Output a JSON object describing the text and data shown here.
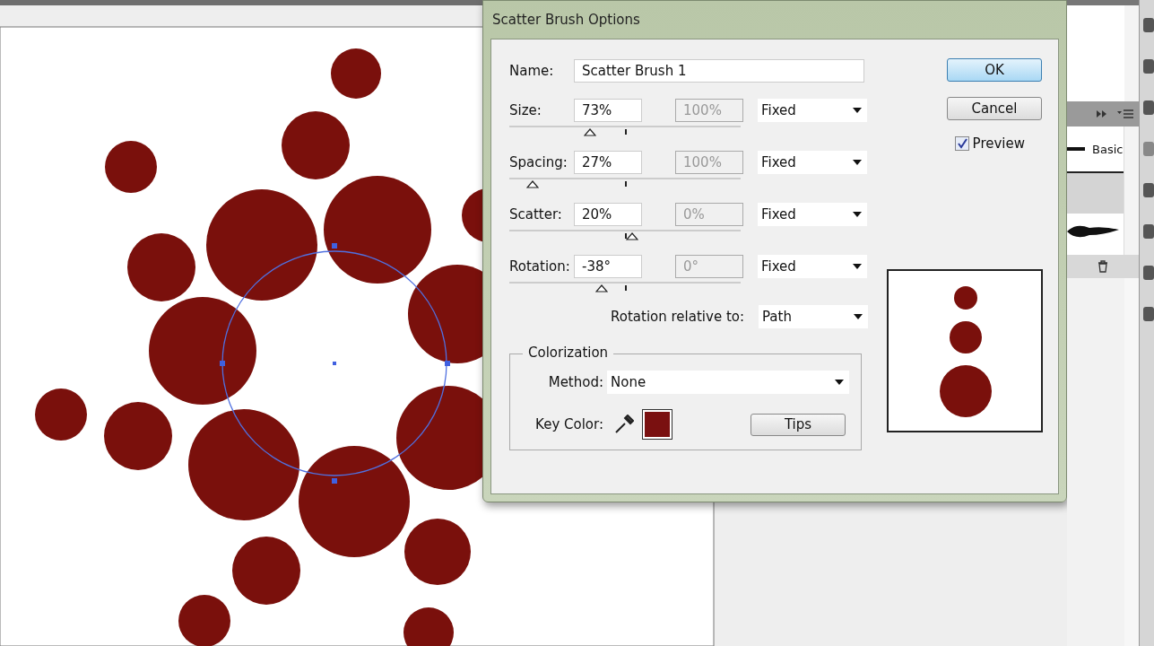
{
  "dialog": {
    "title": "Scatter Brush Options",
    "name": {
      "label": "Name:",
      "value": "Scatter Brush 1"
    },
    "parameters": [
      {
        "label": "Size:",
        "value": "73%",
        "other_value": "100%",
        "mode": "Fixed",
        "level": 0.35
      },
      {
        "label": "Spacing:",
        "value": "27%",
        "other_value": "100%",
        "mode": "Fixed",
        "level": 0.1
      },
      {
        "label": "Scatter:",
        "value": "20%",
        "other_value": "0%",
        "mode": "Fixed",
        "level": 0.53
      },
      {
        "label": "Rotation:",
        "value": "-38°",
        "other_value": "0°",
        "mode": "Fixed",
        "level": 0.4
      }
    ],
    "rotation_relative": {
      "label": "Rotation relative to:",
      "value": "Path"
    },
    "colorization": {
      "title": "Colorization",
      "method_label": "Method:",
      "method": "None",
      "key_color_label": "Key Color:",
      "tips_button": "Tips"
    },
    "buttons": [
      {
        "label": "OK",
        "default": true
      },
      {
        "label": "Cancel",
        "default": false
      }
    ],
    "preview": {
      "label": "Preview",
      "checked": true
    }
  },
  "brushes_panel": {
    "item": "Basic"
  }
}
